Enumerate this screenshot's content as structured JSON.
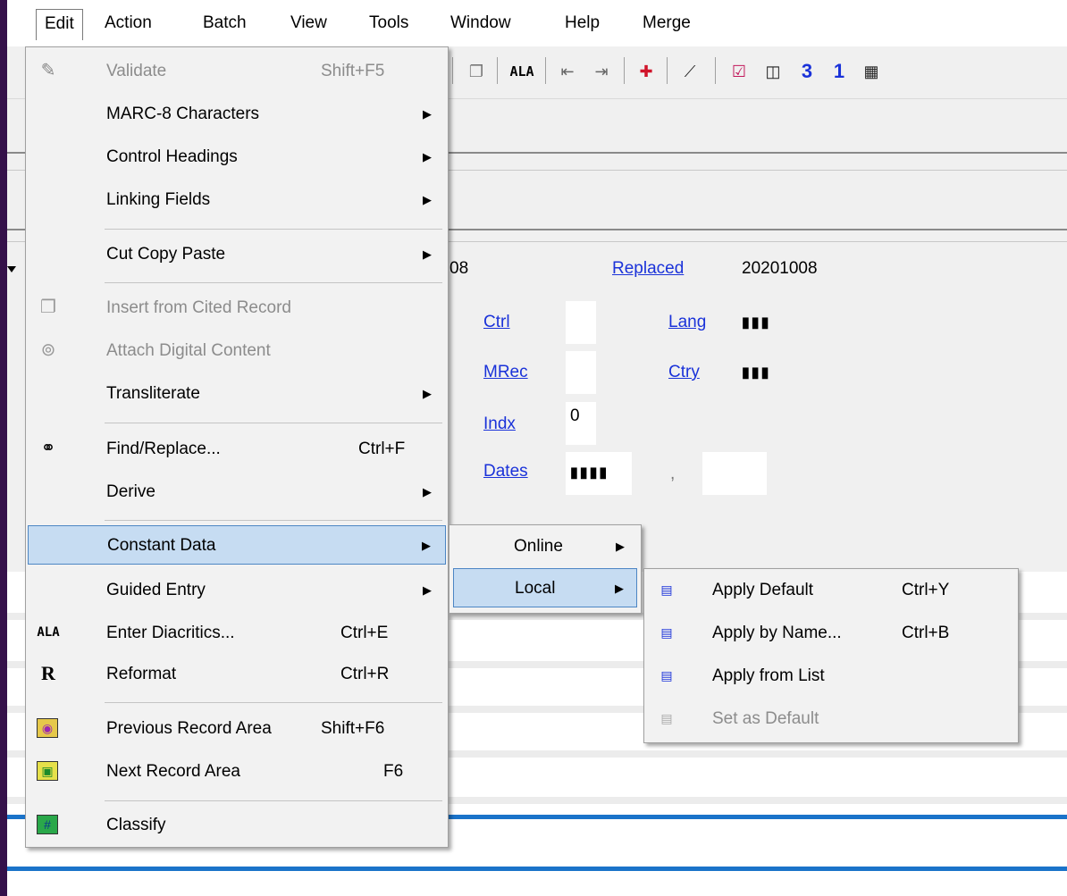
{
  "menubar": {
    "items": [
      {
        "label": "Edit"
      },
      {
        "label": "Action"
      },
      {
        "label": "Batch"
      },
      {
        "label": "View"
      },
      {
        "label": "Tools"
      },
      {
        "label": "Window"
      },
      {
        "label": "Help"
      },
      {
        "label": "Merge"
      }
    ]
  },
  "toolbar": {
    "icons": [
      "cited-record-icon",
      "ala-icon",
      "previous-record-icon",
      "next-record-icon",
      "pin-icon",
      "magic-wand-icon",
      "checkbox-icon",
      "columns-icon",
      "number-3-icon",
      "number-1-icon",
      "window-icon"
    ],
    "ala_label": "ALA",
    "num3": "3",
    "num1": "1"
  },
  "record": {
    "entered_fragment": "08",
    "replaced_label": "Replaced",
    "replaced_value": "20201008",
    "fields": [
      {
        "label": "Ctrl",
        "value": ""
      },
      {
        "label": "Lang",
        "value": "▮▮▮"
      },
      {
        "label": "MRec",
        "value": ""
      },
      {
        "label": "Ctry",
        "value": "▮▮▮"
      },
      {
        "label": "Indx",
        "value": "0"
      },
      {
        "label": "Dates",
        "value": "▮▮▮▮"
      },
      {
        "label": "dates_sep",
        "value": ","
      },
      {
        "label": "dates2",
        "value": ""
      }
    ]
  },
  "edit_menu": {
    "items": [
      {
        "label": "Validate",
        "shortcut": "Shift+F5",
        "icon": "validate-icon",
        "disabled": true
      },
      {
        "label": "MARC-8 Characters",
        "submenu": true
      },
      {
        "label": "Control Headings",
        "submenu": true
      },
      {
        "label": "Linking Fields",
        "submenu": true
      },
      {
        "label": "Cut Copy Paste",
        "submenu": true
      },
      {
        "label": "Insert from Cited Record",
        "icon": "cited-record-icon",
        "disabled": true
      },
      {
        "label": "Attach Digital Content",
        "icon": "attach-icon",
        "disabled": true
      },
      {
        "label": "Transliterate",
        "submenu": true
      },
      {
        "label": "Find/Replace...",
        "shortcut": "Ctrl+F",
        "icon": "binoculars-icon"
      },
      {
        "label": "Derive",
        "submenu": true
      },
      {
        "label": "Constant Data",
        "submenu": true,
        "highlighted": true
      },
      {
        "label": "Guided Entry",
        "submenu": true
      },
      {
        "label": "Enter Diacritics...",
        "shortcut": "Ctrl+E",
        "icon": "ala-icon",
        "icon_text": "ALA"
      },
      {
        "label": "Reformat",
        "shortcut": "Ctrl+R",
        "icon": "reformat-icon",
        "icon_text": "R"
      },
      {
        "label": "Previous Record Area",
        "shortcut": "Shift+F6",
        "icon": "previous-record-area-icon"
      },
      {
        "label": "Next Record Area",
        "shortcut": "F6",
        "icon": "next-record-area-icon"
      },
      {
        "label": "Classify",
        "icon": "classify-icon"
      }
    ]
  },
  "constant_data_menu": {
    "items": [
      {
        "label": "Online",
        "submenu": true
      },
      {
        "label": "Local",
        "submenu": true,
        "highlighted": true
      }
    ]
  },
  "local_menu": {
    "items": [
      {
        "label": "Apply Default",
        "shortcut": "Ctrl+Y",
        "icon": "apply-default-icon"
      },
      {
        "label": "Apply by Name...",
        "shortcut": "Ctrl+B",
        "icon": "apply-by-name-icon"
      },
      {
        "label": "Apply from List",
        "icon": "apply-from-list-icon"
      },
      {
        "label": "Set as Default",
        "icon": "set-default-icon",
        "disabled": true
      }
    ]
  },
  "colors": {
    "link": "#1a32d9",
    "highlight": "#c6dcf2",
    "highlight_border": "#4d86c4",
    "frame": "#2a0f3b",
    "accent_line": "#1a73c9"
  }
}
